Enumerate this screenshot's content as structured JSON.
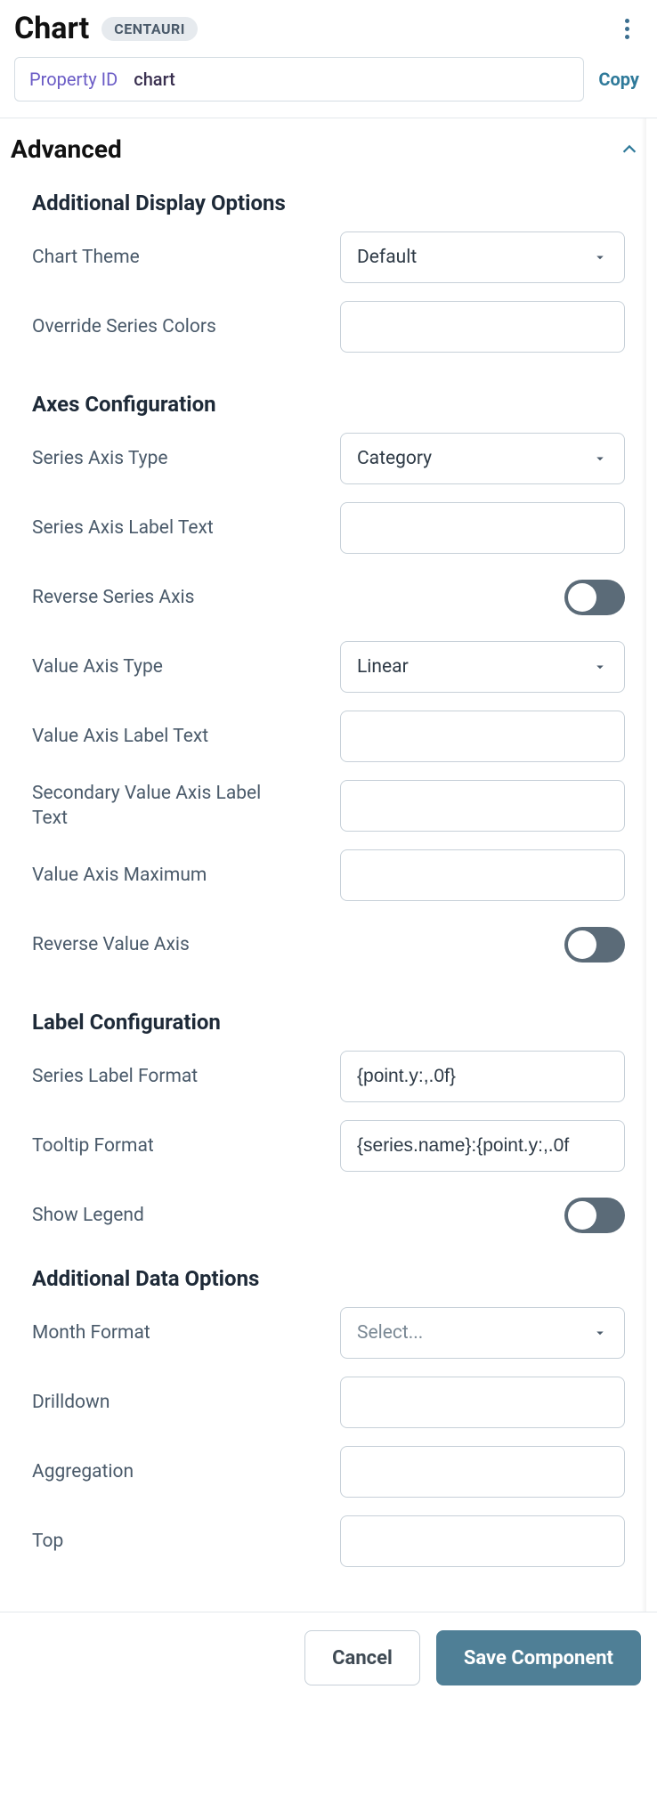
{
  "header": {
    "title": "Chart",
    "badge": "CENTAURI"
  },
  "property": {
    "label": "Property ID",
    "value": "chart",
    "copy": "Copy"
  },
  "section": {
    "title": "Advanced"
  },
  "groups": {
    "display": {
      "heading": "Additional Display Options",
      "chart_theme": {
        "label": "Chart Theme",
        "value": "Default"
      },
      "override_colors": {
        "label": "Override Series Colors",
        "value": ""
      }
    },
    "axes": {
      "heading": "Axes Configuration",
      "series_axis_type": {
        "label": "Series Axis Type",
        "value": "Category"
      },
      "series_axis_label": {
        "label": "Series Axis Label Text",
        "value": ""
      },
      "reverse_series": {
        "label": "Reverse Series Axis",
        "on": false
      },
      "value_axis_type": {
        "label": "Value Axis Type",
        "value": "Linear"
      },
      "value_axis_label": {
        "label": "Value Axis Label Text",
        "value": ""
      },
      "secondary_value_label": {
        "label": "Secondary Value Axis Label Text",
        "value": ""
      },
      "value_axis_max": {
        "label": "Value Axis Maximum",
        "value": ""
      },
      "reverse_value": {
        "label": "Reverse Value Axis",
        "on": false
      }
    },
    "labels": {
      "heading": "Label Configuration",
      "series_label_format": {
        "label": "Series Label Format",
        "value": "{point.y:,.0f}"
      },
      "tooltip_format": {
        "label": "Tooltip Format",
        "value": "{series.name}:{point.y:,.0f"
      },
      "show_legend": {
        "label": "Show Legend",
        "on": false
      }
    },
    "data": {
      "heading": "Additional Data Options",
      "month_format": {
        "label": "Month Format",
        "placeholder": "Select...",
        "value": ""
      },
      "drilldown": {
        "label": "Drilldown",
        "value": ""
      },
      "aggregation": {
        "label": "Aggregation",
        "value": ""
      },
      "top": {
        "label": "Top",
        "value": ""
      }
    }
  },
  "footer": {
    "cancel": "Cancel",
    "save": "Save Component"
  }
}
